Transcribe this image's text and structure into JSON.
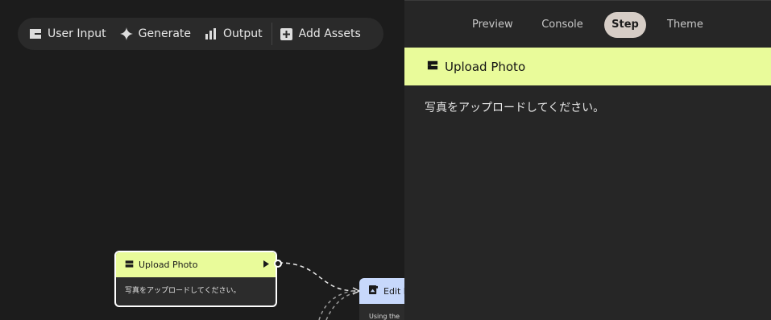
{
  "toolbar": {
    "items": [
      {
        "label": "User Input",
        "icon": "input-icon"
      },
      {
        "label": "Generate",
        "icon": "sparkle-icon"
      },
      {
        "label": "Output",
        "icon": "bar-chart-icon"
      },
      {
        "label": "Add Assets",
        "icon": "add-box-icon"
      }
    ]
  },
  "canvas": {
    "node_upload": {
      "title": "Upload Photo",
      "description": "写真をアップロードしてください。"
    },
    "node_edit": {
      "title": "Edit P",
      "description": "Using the"
    }
  },
  "panel": {
    "tabs": [
      "Preview",
      "Console",
      "Step",
      "Theme"
    ],
    "active_tab": "Step",
    "step": {
      "title": "Upload Photo",
      "text": "写真をアップロードしてください。"
    }
  },
  "colors": {
    "input_node_accent": "#e9fb9a",
    "generate_node_accent": "#c7d8fb",
    "active_tab_bg": "#d6cdc6"
  }
}
